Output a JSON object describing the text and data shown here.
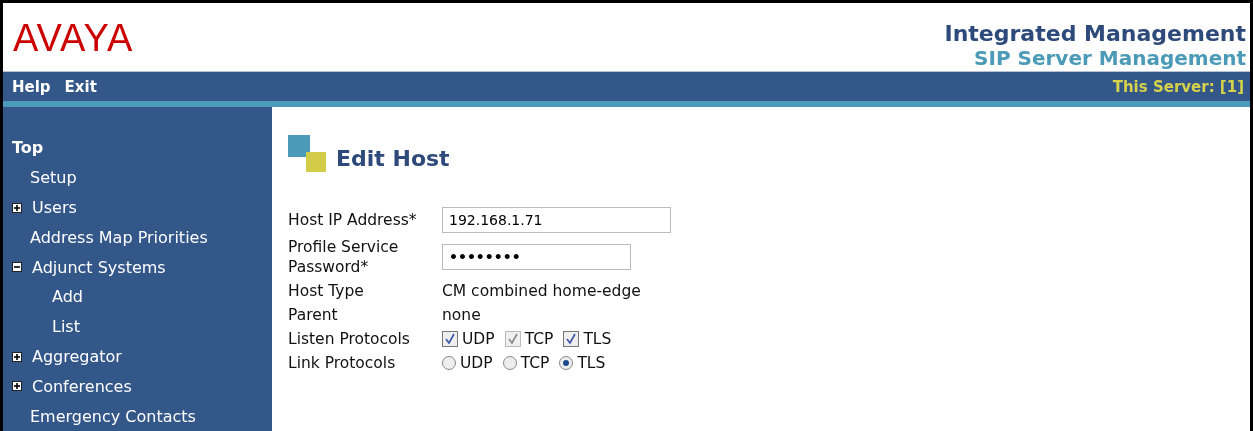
{
  "header": {
    "logo": "AVAYA",
    "title": "Integrated Management",
    "subtitle": "SIP Server Management"
  },
  "nav": {
    "links": [
      "Help",
      "Exit"
    ],
    "server": "This Server: [1]"
  },
  "sidebar": {
    "items": [
      {
        "label": "Top",
        "children": [
          {
            "label": "Setup"
          },
          {
            "label": "Users",
            "expanded": false
          },
          {
            "label": "Address Map Priorities"
          },
          {
            "label": "Adjunct Systems",
            "expanded": true,
            "children": [
              {
                "label": "Add"
              },
              {
                "label": "List"
              }
            ]
          },
          {
            "label": "Aggregator",
            "expanded": false
          },
          {
            "label": "Conferences",
            "expanded": false
          },
          {
            "label": "Emergency Contacts"
          }
        ]
      }
    ]
  },
  "page": {
    "title": "Edit Host",
    "fields": [
      {
        "kind": "input",
        "label": "Host IP Address*",
        "value": "192.168.1.71"
      },
      {
        "kind": "password",
        "label": "Profile Service Password*",
        "value": "••••••••"
      },
      {
        "kind": "text",
        "label": "Host Type",
        "value": "CM combined home-edge"
      },
      {
        "kind": "text",
        "label": "Parent",
        "value": "none"
      },
      {
        "kind": "checkboxes",
        "label": "Listen Protocols",
        "options": [
          {
            "label": "UDP",
            "checked": true,
            "disabled": false
          },
          {
            "label": "TCP",
            "checked": true,
            "disabled": true
          },
          {
            "label": "TLS",
            "checked": true,
            "disabled": false
          }
        ]
      },
      {
        "kind": "radios",
        "label": "Link Protocols",
        "options": [
          {
            "label": "UDP",
            "selected": false
          },
          {
            "label": "TCP",
            "selected": false
          },
          {
            "label": "TLS",
            "selected": true
          }
        ]
      }
    ]
  }
}
